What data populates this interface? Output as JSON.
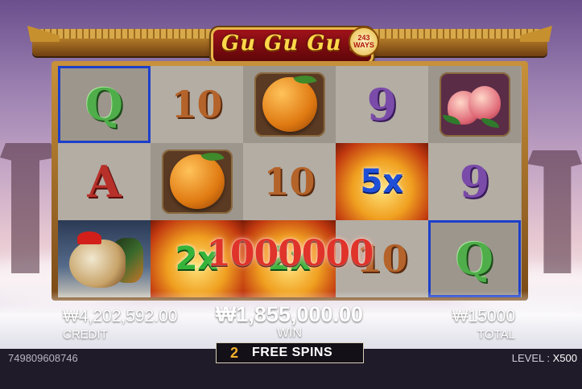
{
  "game": {
    "logo_text": "Gu Gu Gu 3",
    "ways_number": "243",
    "ways_label": "WAYS"
  },
  "reels": [
    [
      {
        "symbol": "q-symbol",
        "label": "Q",
        "highlighted": true
      },
      {
        "symbol": "a-symbol",
        "label": "A",
        "highlighted": false
      },
      {
        "symbol": "rooster-symbol",
        "label": "",
        "highlighted": false
      }
    ],
    [
      {
        "symbol": "ten-symbol",
        "label": "10",
        "highlighted": false
      },
      {
        "symbol": "orange-symbol",
        "label": "",
        "highlighted": false
      },
      {
        "symbol": "gold-ingot-multiplier-symbol",
        "label": "2x",
        "highlighted": true
      }
    ],
    [
      {
        "symbol": "orange-symbol",
        "label": "",
        "highlighted": false
      },
      {
        "symbol": "ten-symbol",
        "label": "10",
        "highlighted": false
      },
      {
        "symbol": "gold-ingot-multiplier-symbol",
        "label": "2x",
        "highlighted": true
      }
    ],
    [
      {
        "symbol": "nine-symbol",
        "label": "9",
        "highlighted": false
      },
      {
        "symbol": "gold-ingot-multiplier-symbol",
        "label": "5x",
        "highlighted": true
      },
      {
        "symbol": "ten-symbol",
        "label": "10",
        "highlighted": false
      }
    ],
    [
      {
        "symbol": "peach-symbol",
        "label": "",
        "highlighted": false
      },
      {
        "symbol": "nine-symbol",
        "label": "9",
        "highlighted": false
      },
      {
        "symbol": "q-symbol",
        "label": "Q",
        "highlighted": true
      }
    ]
  ],
  "big_win_amount": "1000000",
  "credit": {
    "value": "₩4,202,592.00",
    "label": "CREDIT"
  },
  "win": {
    "value": "₩1,855,000.00",
    "label": "WIN"
  },
  "total": {
    "value": "₩15000",
    "label": "TOTAL"
  },
  "free_spins": {
    "count": "2",
    "label": "FREE SPINS"
  },
  "footer": {
    "session_id": "749809608746",
    "level_label": "LEVEL :",
    "level_value": "X500"
  },
  "colors": {
    "highlight_border": "#1d3fc9",
    "win_text": "#e0332a",
    "free_spin_count": "#f0b02a"
  }
}
